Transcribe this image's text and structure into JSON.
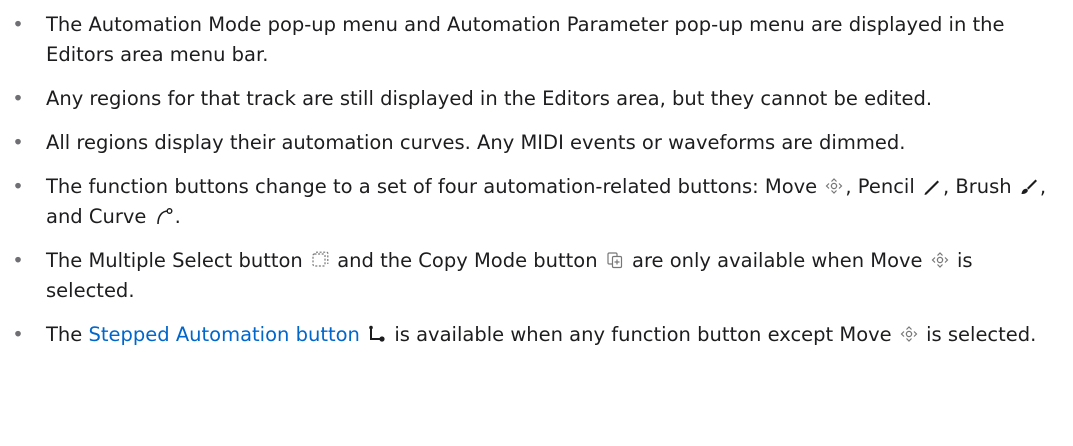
{
  "items": [
    {
      "text": "The Automation Mode pop-up menu and Automation Parameter pop-up menu are displayed in the Editors area menu bar."
    },
    {
      "text": "Any regions for that track are still displayed in the Editors area, but they cannot be edited."
    },
    {
      "text": "All regions display their automation curves. Any MIDI events or waveforms are dimmed."
    },
    {
      "part1": "The function buttons change to a set of four automation-related buttons: Move ",
      "part2": ", Pencil ",
      "part3": ", Brush ",
      "part4": ", and Curve ",
      "part5": ".",
      "icons": [
        "move-icon",
        "pencil-icon",
        "brush-icon",
        "curve-icon"
      ]
    },
    {
      "part1": "The Multiple Select button ",
      "part2": " and the Copy Mode button ",
      "part3": " are only available when Move ",
      "part4": " is selected.",
      "icons": [
        "multiple-select-icon",
        "copy-mode-icon",
        "move-icon"
      ]
    },
    {
      "part1": "The ",
      "link": "Stepped Automation button",
      "part2": " ",
      "part3": " is available when any function button except Move ",
      "part4": " is selected.",
      "icons": [
        "stepped-automation-icon",
        "move-icon"
      ]
    }
  ],
  "bullet_char": "•",
  "colors": {
    "text": "#1d1d1f",
    "link": "#0066cc",
    "bullet": "#6e6e73"
  }
}
